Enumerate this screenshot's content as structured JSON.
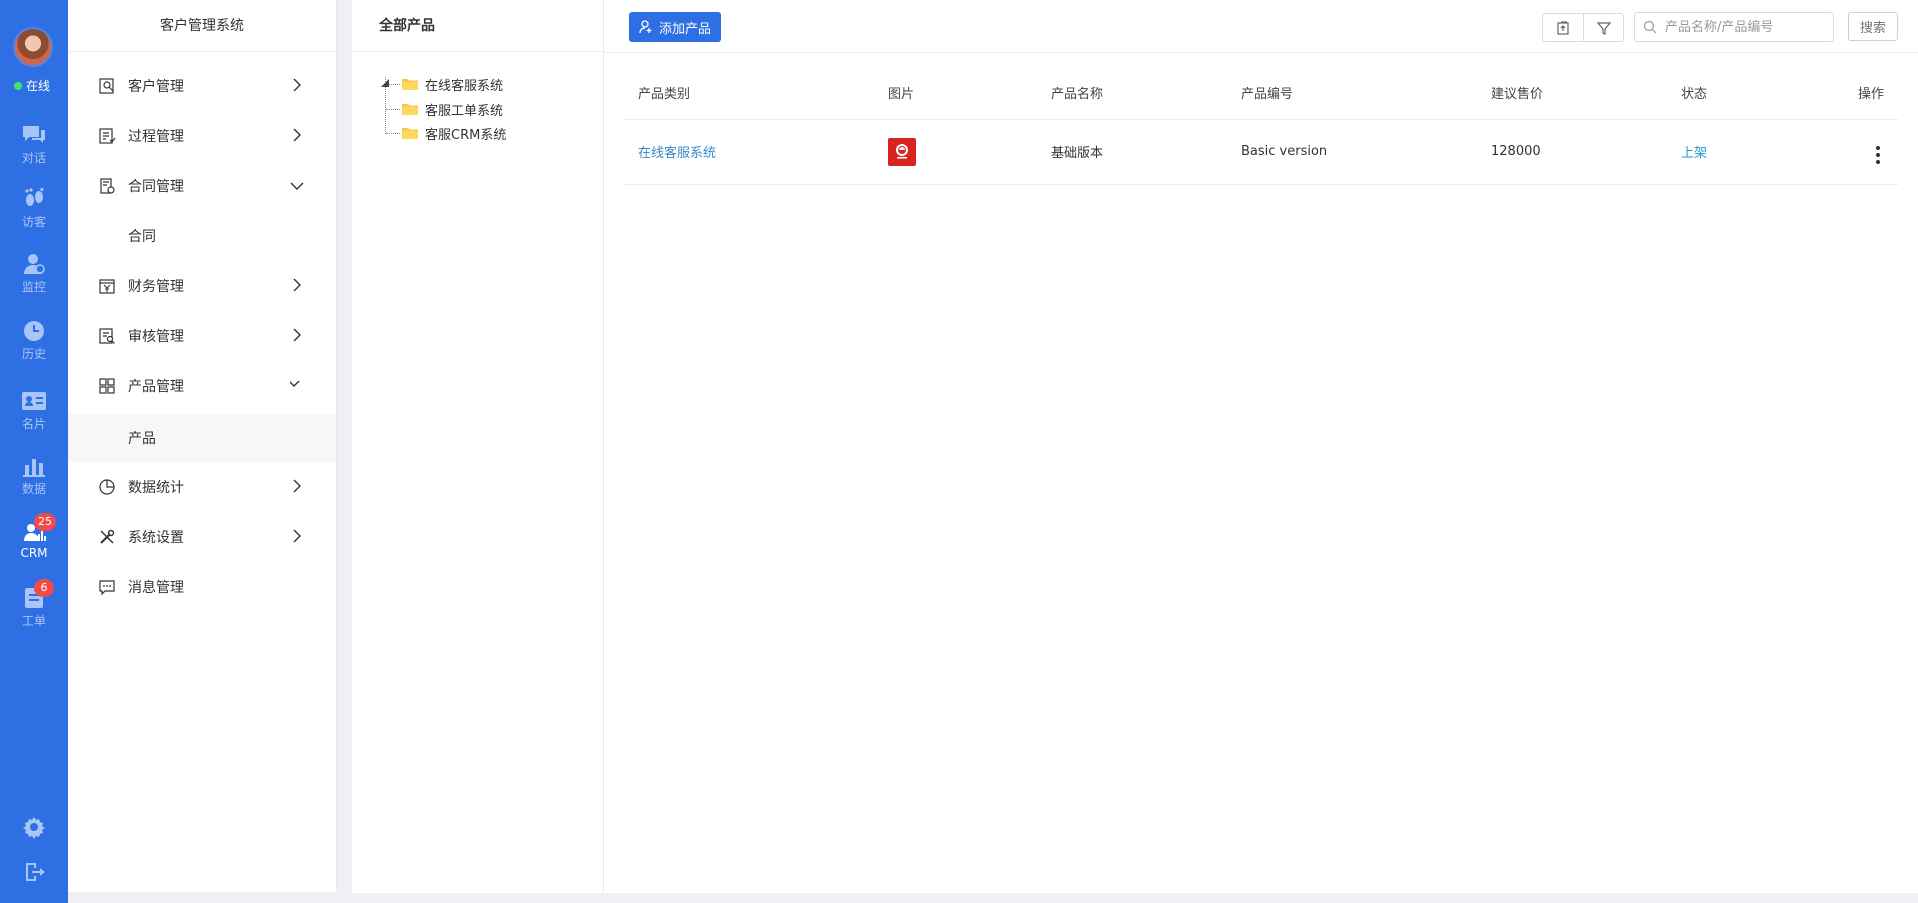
{
  "rail": {
    "online_label": "在线",
    "items": [
      {
        "label": "对话",
        "icon": "chat-icon"
      },
      {
        "label": "访客",
        "icon": "footprint-icon"
      },
      {
        "label": "监控",
        "icon": "monitor-user-icon"
      },
      {
        "label": "历史",
        "icon": "clock-icon"
      },
      {
        "label": "名片",
        "icon": "id-card-icon"
      },
      {
        "label": "数据",
        "icon": "bar-chart-icon"
      },
      {
        "label": "CRM",
        "icon": "crm-icon",
        "badge": "25"
      },
      {
        "label": "工单",
        "icon": "ticket-icon",
        "badge": "6"
      }
    ],
    "accent": "#2f6fe4"
  },
  "menu": {
    "title": "客户管理系统",
    "items": [
      {
        "label": "客户管理",
        "icon": "customer-search-icon"
      },
      {
        "label": "过程管理",
        "icon": "process-icon"
      },
      {
        "label": "合同管理",
        "icon": "contract-icon",
        "expanded": true
      },
      {
        "label": "合同"
      },
      {
        "label": "财务管理",
        "icon": "finance-icon"
      },
      {
        "label": "审核管理",
        "icon": "audit-icon"
      },
      {
        "label": "产品管理",
        "icon": "product-grid-icon",
        "expanded": true
      },
      {
        "label": "产品",
        "selected": true
      },
      {
        "label": "数据统计",
        "icon": "pie-chart-icon"
      },
      {
        "label": "系统设置",
        "icon": "tools-icon"
      },
      {
        "label": "消息管理",
        "icon": "message-icon"
      }
    ]
  },
  "tree": {
    "title": "全部产品",
    "nodes": [
      "在线客服系统",
      "客服工单系统",
      "客服CRM系统"
    ]
  },
  "toolbar": {
    "add_label": "添加产品",
    "search_placeholder": "产品名称/产品编号",
    "search_button": "搜索"
  },
  "table": {
    "headers": [
      "产品类别",
      "图片",
      "产品名称",
      "产品编号",
      "建议售价",
      "状态",
      "操作"
    ],
    "rows": [
      {
        "category": "在线客服系统",
        "image": "product-logo",
        "name": "基础版本",
        "code": "Basic version",
        "price": "128000",
        "status": "上架"
      }
    ]
  }
}
